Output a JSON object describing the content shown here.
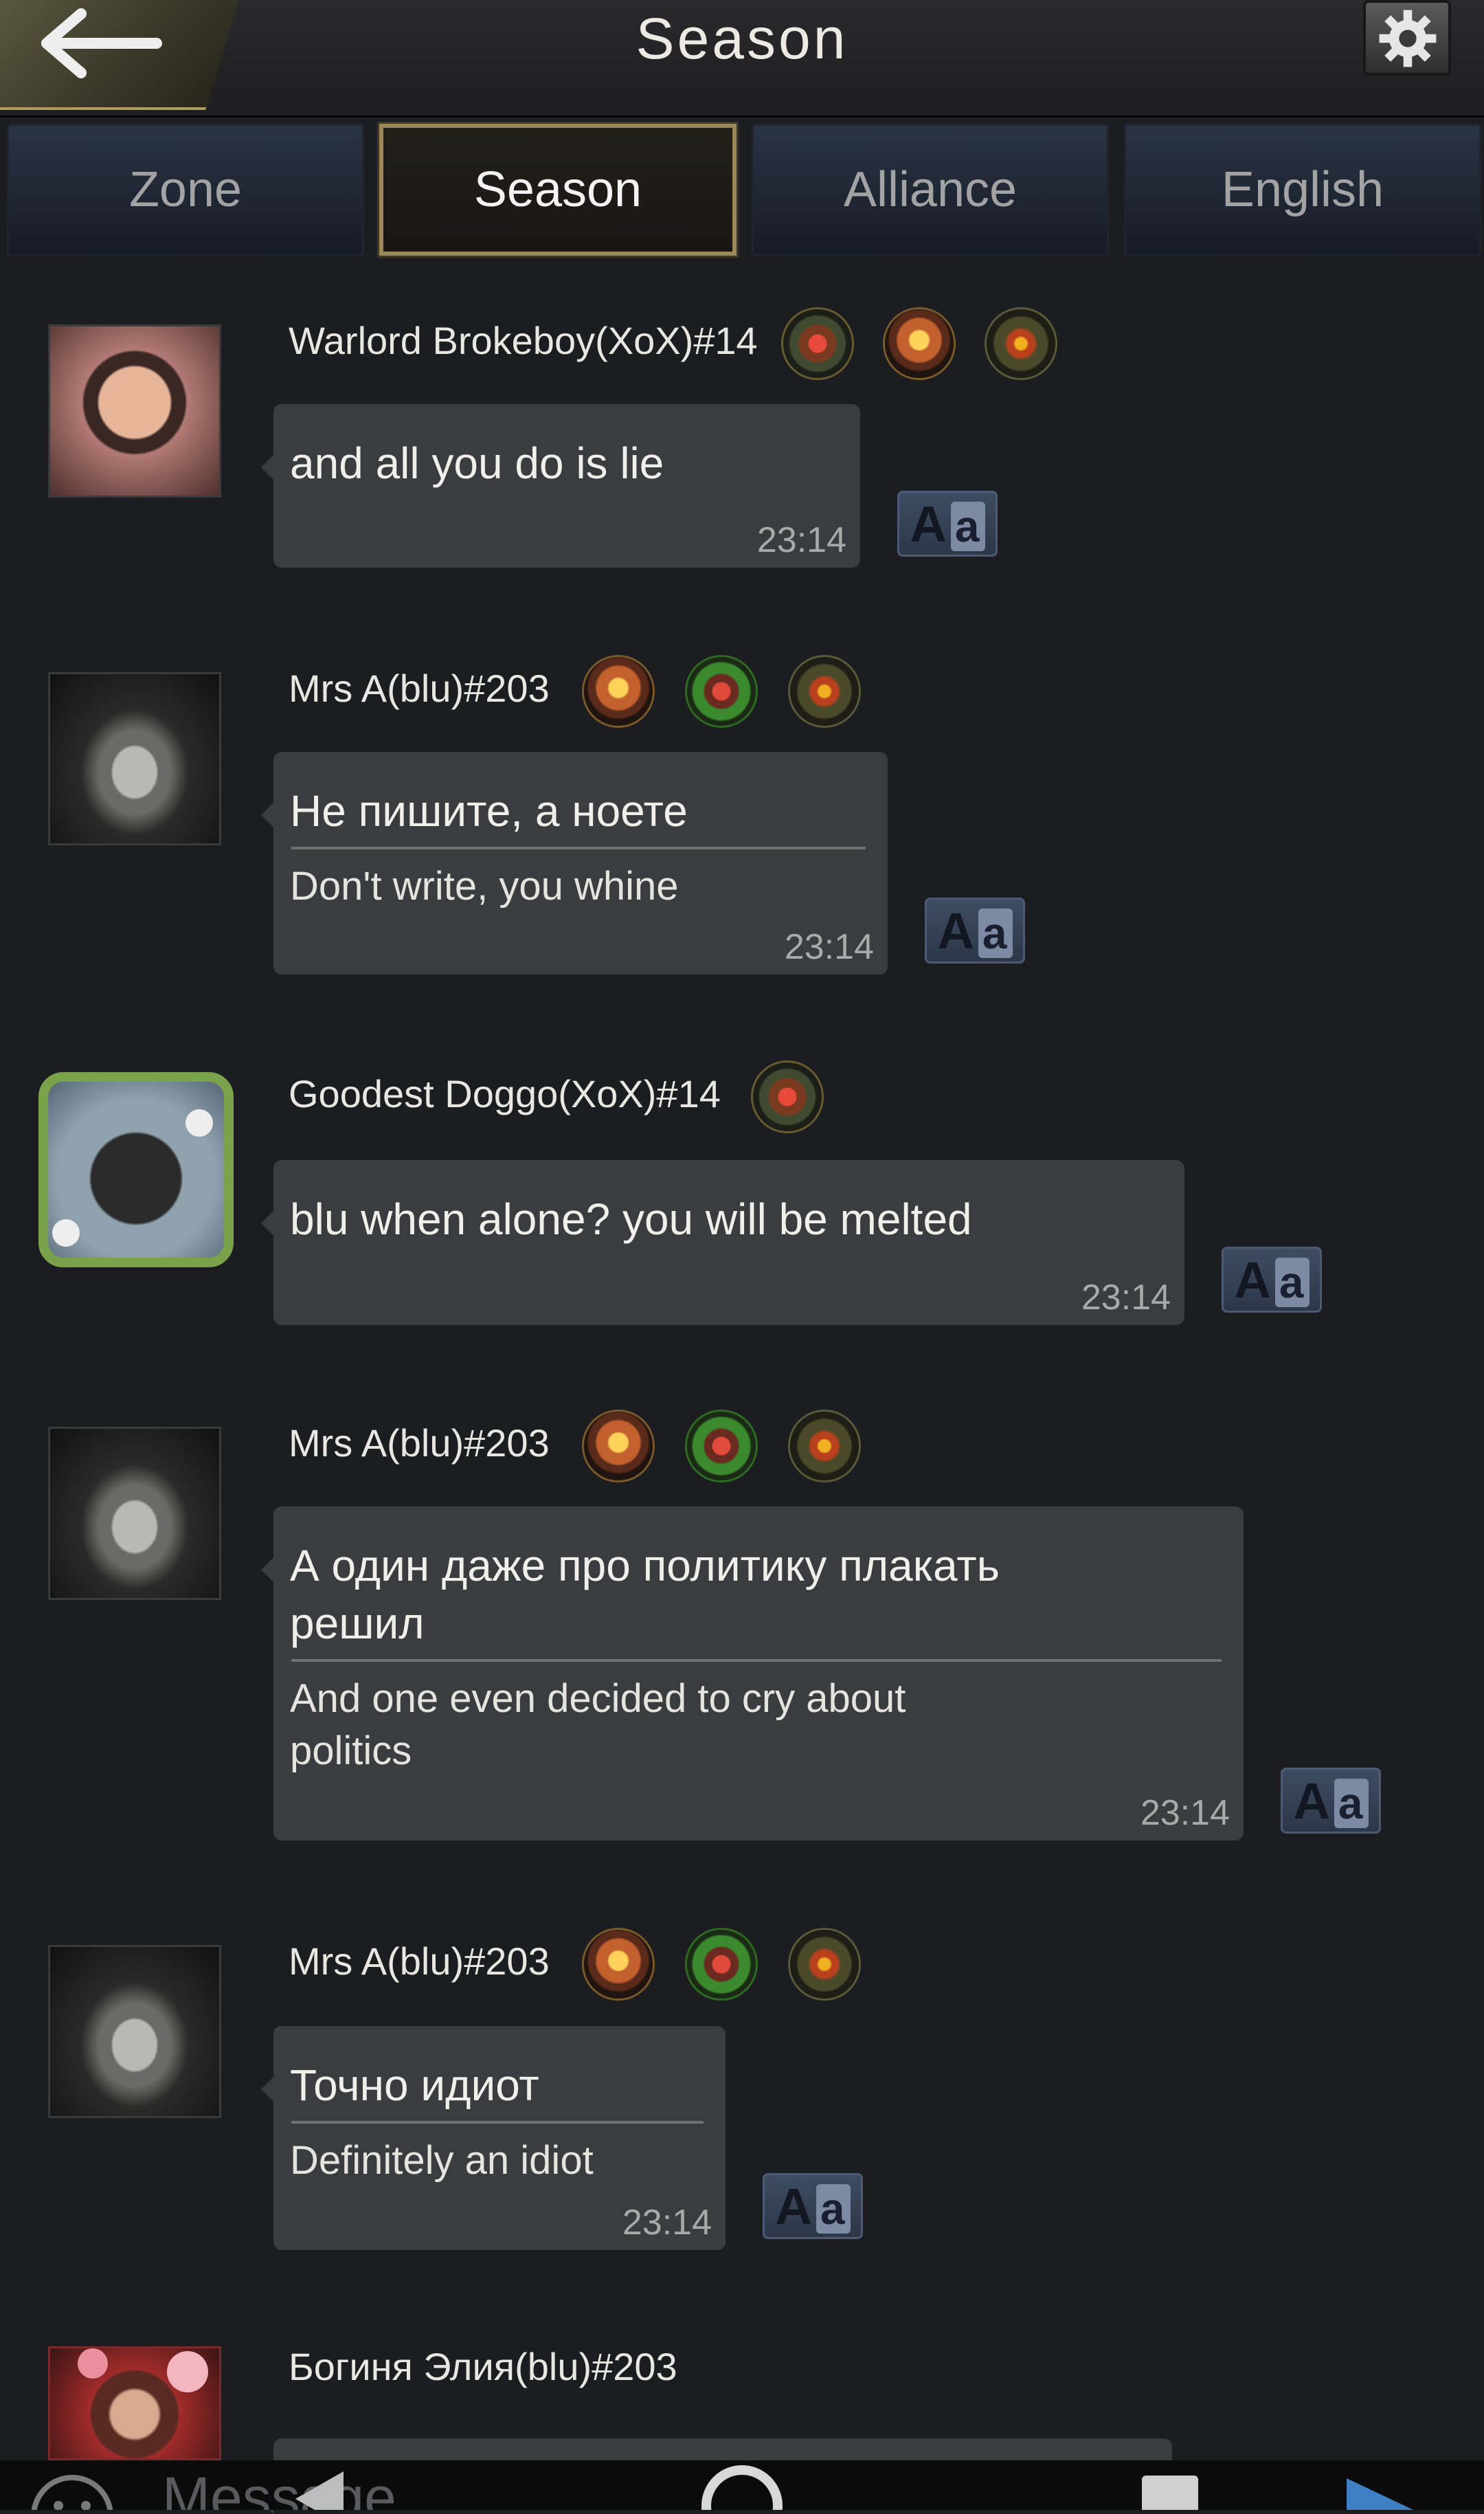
{
  "header": {
    "title": "Season"
  },
  "tabs": [
    {
      "label": "Zone",
      "active": false
    },
    {
      "label": "Season",
      "active": true
    },
    {
      "label": "Alliance",
      "active": false
    },
    {
      "label": "English",
      "active": false
    }
  ],
  "messages": [
    {
      "username": "Warlord Brokeboy(XoX)#14",
      "text": "and all you do is lie",
      "time": "23:14"
    },
    {
      "username": "Mrs A(blu)#203",
      "text": "Не пишите, а ноете",
      "translation": "Don't write, you whine",
      "time": "23:14"
    },
    {
      "username": "Goodest Doggo(XoX)#14",
      "text": "blu when alone? you will be melted",
      "time": "23:14"
    },
    {
      "username": "Mrs A(blu)#203",
      "text": "А один даже про политику плакать\n решил",
      "translation": "And one even decided to cry about\npolitics",
      "time": "23:14"
    },
    {
      "username": "Mrs A(blu)#203",
      "text": "Точно идиот",
      "translation": "Definitely an idiot",
      "time": "23:14"
    },
    {
      "username": "Богиня Элия(blu)#203"
    }
  ],
  "translate_button": {
    "label_upper": "A",
    "label_lower": "a"
  },
  "input": {
    "placeholder": "Message"
  },
  "icons": {
    "back": "arrow-left-icon",
    "settings": "gear-icon",
    "translate": "translate-icon",
    "emoji": "emoji-icon",
    "nav_back": "triangle-back-icon",
    "nav_home": "circle-home-icon",
    "nav_recents": "square-recents-icon",
    "send": "send-icon"
  },
  "colors": {
    "background": "#1c1d20",
    "bubble": "#3b3c40",
    "active_tab_border": "#9c8759",
    "tab_bg": "#2b3445",
    "translate_button": "#3f4d63"
  }
}
